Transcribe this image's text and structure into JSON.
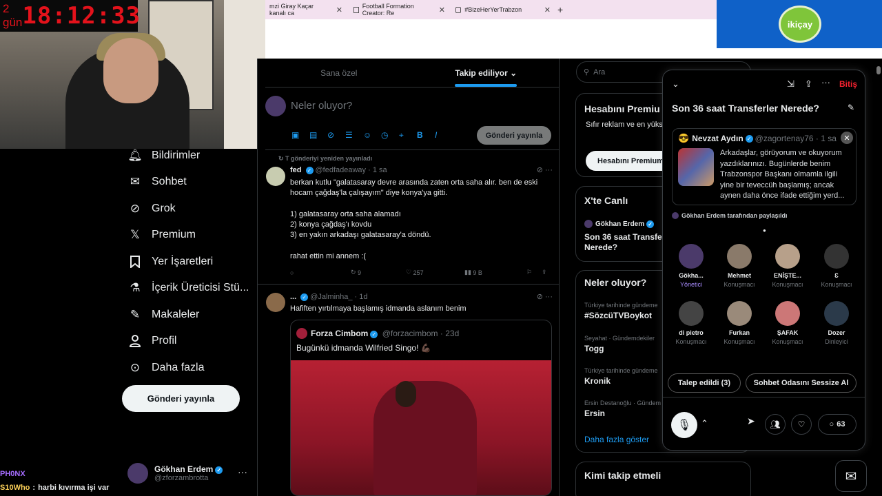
{
  "overlay": {
    "timer_days": "2 gün",
    "timer_clock": "18:12:33",
    "sponsor_text": "ikiçay",
    "chat": [
      {
        "user": "PH0NX",
        "message": ""
      },
      {
        "user": "S10Who",
        "message": "harbi kıvırma işi var"
      }
    ]
  },
  "browser": {
    "tabs": [
      {
        "label": "mzi Giray Kaçar kanalı ca"
      },
      {
        "label": "Football Formation Creator: Re"
      },
      {
        "label": "#BizeHerYerTrabzon"
      }
    ],
    "new_tab": "+"
  },
  "sidebar": {
    "items": [
      {
        "label": "Bildirimler",
        "icon": "bell-icon"
      },
      {
        "label": "Sohbet",
        "icon": "mail-icon"
      },
      {
        "label": "Grok",
        "icon": "grok-icon"
      },
      {
        "label": "Premium",
        "icon": "x-logo-icon"
      },
      {
        "label": "Yer İşaretleri",
        "icon": "bookmark-icon"
      },
      {
        "label": "İçerik Üreticisi Stü...",
        "icon": "flask-icon"
      },
      {
        "label": "Makaleler",
        "icon": "article-icon"
      },
      {
        "label": "Profil",
        "icon": "person-icon"
      },
      {
        "label": "Daha fazla",
        "icon": "more-circle-icon"
      }
    ],
    "post_button": "Gönderi yayınla",
    "profile": {
      "name": "Gökhan Erdem",
      "handle": "@zforzambrotta",
      "more": "···"
    }
  },
  "feed": {
    "tabs": [
      {
        "label": "Sana özel"
      },
      {
        "label": "Takip ediliyor ⌄"
      }
    ],
    "compose_placeholder": "Neler oluyor?",
    "compose_button": "Gönderi yayınla",
    "tweets": [
      {
        "repost_note": "T gönderiyi yeniden yayınladı",
        "name": "fed",
        "handle": "@fedfadeaway",
        "time": "· 1 sa",
        "text": "berkan kutlu \"galatasaray devre arasında zaten orta saha alır. ben de eski hocam çağdaş'la çalışayım\" diye konya'ya gitti.\n\n1) galatasaray orta saha alamadı\n2) konya çağdaş'ı kovdu\n3) en yakın arkadaşı galatasaray'a döndü.\n\nrahat ettin mi annem :(",
        "reposts": "9",
        "likes": "257",
        "views": "9 B"
      },
      {
        "name": "...",
        "handle": "@Jalminha_",
        "time": "· 1d",
        "text": "Hafiften yırtılmaya başlamış idmanda aslanım benim",
        "quote": {
          "name": "Forza Cimbom",
          "handle": "@forzacimbom",
          "time": "· 23d",
          "text": "Bugünkü idmanda Wilfried Singo! 💪🏿"
        }
      }
    ]
  },
  "right": {
    "search_placeholder": "Ara",
    "premium": {
      "title": "Hesabını Premiu",
      "text": "Sıfır reklam ve en yüks avantajlarının tadını ç",
      "button": "Hesabını Premium"
    },
    "live": {
      "title": "X'te Canlı",
      "host": "Gökhan Erdem",
      "space": "Son 36 saat Transfer Nerede?"
    },
    "trends_title": "Neler oluyor?",
    "trends": [
      {
        "context": "Türkiye tarihinde gündeme",
        "name": "#SözcüTVBoykot"
      },
      {
        "context": "Seyahat · Gündemdekiler",
        "name": "Togg"
      },
      {
        "context": "Türkiye tarihinde gündeme",
        "name": "Kronik"
      },
      {
        "context": "Ersin Destanoğlu · Gündem",
        "name": "Ersin"
      }
    ],
    "show_more": "Daha fazla göster",
    "who_to_follow": "Kimi takip etmeli"
  },
  "space": {
    "end_label": "Bitiş",
    "title": "Son 36 saat Transferler Nerede?",
    "pinned": {
      "name": "Nevzat Aydın",
      "handle": "@zagortenay76",
      "time": "· 1 sa",
      "text": "Arkadaşlar, görüyorum ve okuyorum yazdıklarınızı. Bugünlerde benim Trabzonspor Başkanı olmamla ilgili yine bir teveccüh başlamış; ancak aynen daha önce ifade ettiğim yerd..."
    },
    "shared_by": "Gökhan Erdem tarafından paylaşıldı",
    "speakers": [
      {
        "name": "Gökha...",
        "role": "Yönetici"
      },
      {
        "name": "Mehmet",
        "role": "Konuşmacı"
      },
      {
        "name": "ENİŞTE...",
        "role": "Konuşmacı"
      },
      {
        "name": "Ɛ",
        "role": "Konuşmacı"
      },
      {
        "name": "di pietro",
        "role": "Konuşmacı"
      },
      {
        "name": "Furkan",
        "role": "Konuşmacı"
      },
      {
        "name": "ŞAFAK",
        "role": "Konuşmacı"
      },
      {
        "name": "Dozer",
        "role": "Dinleyici"
      }
    ],
    "requests_button": "Talep edildi (3)",
    "mute_button": "Sohbet Odasını Sessize Al",
    "comments": "63"
  }
}
